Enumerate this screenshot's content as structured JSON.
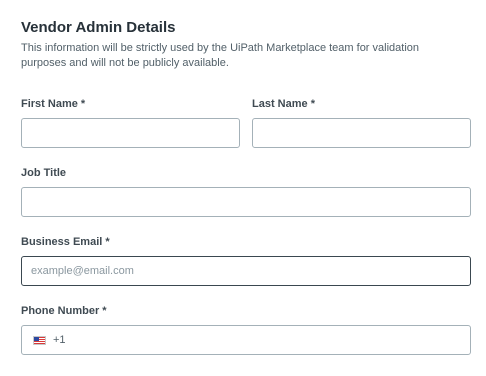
{
  "section": {
    "title": "Vendor Admin Details",
    "description": "This information will be strictly used by the UiPath Marketplace team for validation purposes and will not be publicly available."
  },
  "fields": {
    "first_name": {
      "label": "First Name *",
      "value": ""
    },
    "last_name": {
      "label": "Last Name *",
      "value": ""
    },
    "job_title": {
      "label": "Job Title",
      "value": ""
    },
    "business_email": {
      "label": "Business Email *",
      "value": "",
      "placeholder": "example@email.com"
    },
    "phone_number": {
      "label": "Phone Number *",
      "dial_code": "+1",
      "country_flag": "us-flag-icon",
      "value": ""
    }
  },
  "colors": {
    "text": "#273139",
    "muted": "#526069",
    "border": "#a4b1b8",
    "focused_border": "#3a4750"
  }
}
